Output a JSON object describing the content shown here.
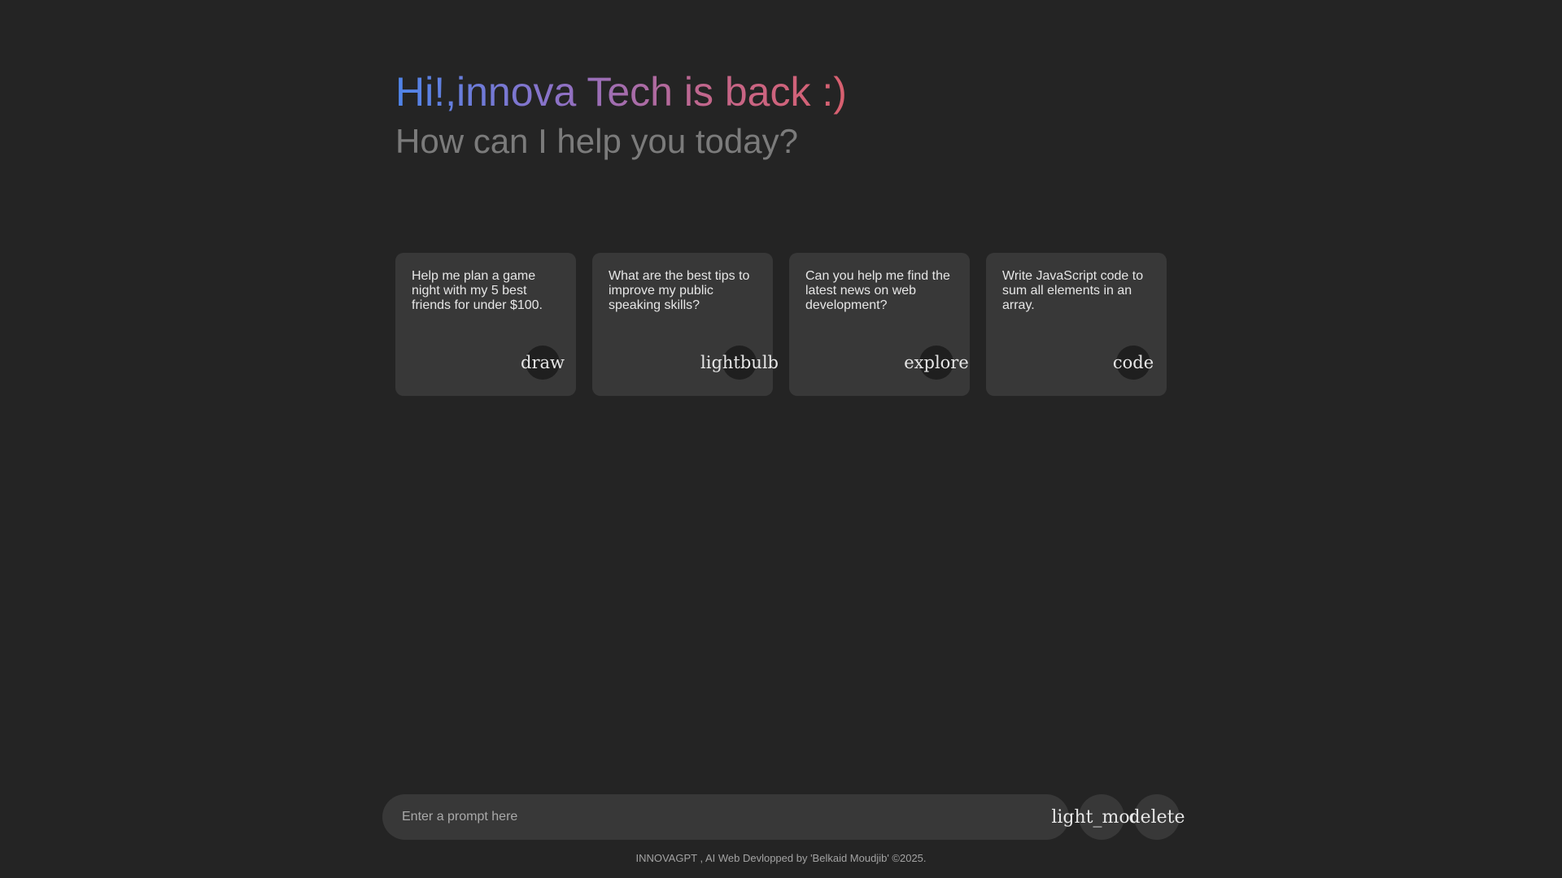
{
  "header": {
    "greeting": "Hi!,innova Tech is back :)",
    "subtitle": "How can I help you today?"
  },
  "cards": [
    {
      "text": "Help me plan a game night with my 5 best friends for under $100.",
      "icon": "draw"
    },
    {
      "text": "What are the best tips to improve my public speaking skills?",
      "icon": "lightbulb"
    },
    {
      "text": "Can you help me find the latest news on web development?",
      "icon": "explore"
    },
    {
      "text": "Write JavaScript code to sum all elements in an array.",
      "icon": "code"
    }
  ],
  "prompt": {
    "placeholder": "Enter a prompt here",
    "theme_button": "light_mode",
    "delete_button": "delete"
  },
  "footer": {
    "text": "INNOVAGPT , AI Web Devlopped by 'Belkaid Moudjib' ©2025."
  },
  "colors": {
    "background": "#242424",
    "card": "#383838",
    "gradient_start": "#4f85ea",
    "gradient_end": "#d8606f"
  }
}
